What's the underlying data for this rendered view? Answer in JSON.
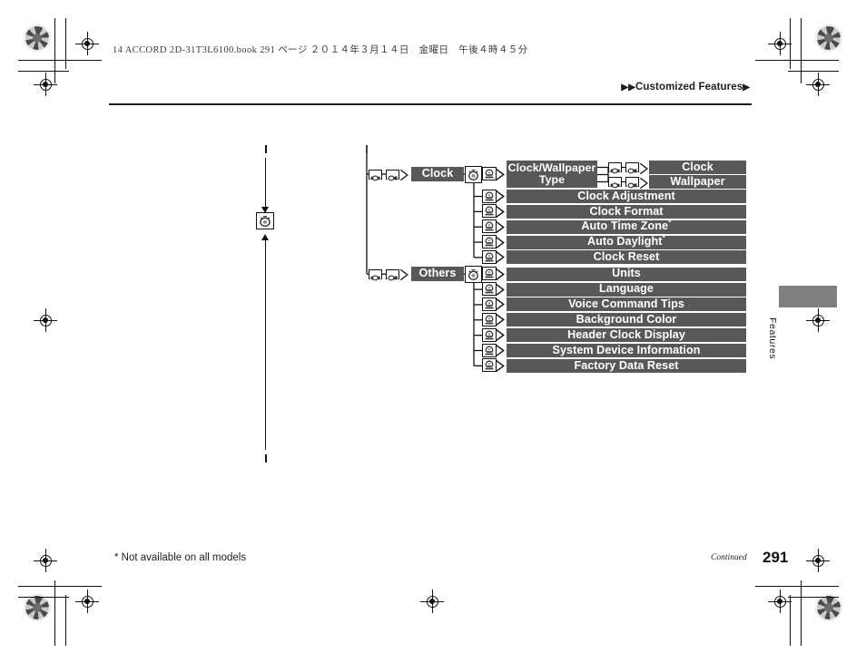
{
  "page": {
    "book_line": "14 ACCORD 2D-31T3L6100.book  291 ページ  ２０１４年３月１４日　金曜日　午後４時４５分",
    "running_head": "Customized Features",
    "running_head_tri_left": "▶▶",
    "running_head_tri_right": "▶",
    "side_tab_label": "Features",
    "footnote": "* Not available on all models",
    "continued": "Continued",
    "page_number": "291"
  },
  "colors": {
    "bar_fill": "#585858",
    "bar_text": "#ffffff",
    "line": "#111111",
    "side_tab": "#808080"
  },
  "diagram": {
    "branches": [
      {
        "id": "clock",
        "label": "Clock",
        "items": [
          {
            "label": "Clock/Wallpaper Type",
            "two_line": true,
            "star": false,
            "sub": [
              {
                "label": "Clock"
              },
              {
                "label": "Wallpaper"
              }
            ]
          },
          {
            "label": "Clock Adjustment",
            "star": false,
            "sub": []
          },
          {
            "label": "Clock Format",
            "star": false,
            "sub": []
          },
          {
            "label": "Auto Time Zone",
            "star": true,
            "sub": []
          },
          {
            "label": "Auto Daylight",
            "star": true,
            "sub": []
          },
          {
            "label": "Clock Reset",
            "star": false,
            "sub": []
          }
        ]
      },
      {
        "id": "others",
        "label": "Others",
        "items": [
          {
            "label": "Units",
            "star": false,
            "sub": []
          },
          {
            "label": "Language",
            "star": false,
            "sub": []
          },
          {
            "label": "Voice Command Tips",
            "star": false,
            "sub": []
          },
          {
            "label": "Background Color",
            "star": false,
            "sub": []
          },
          {
            "label": "Header Clock Display",
            "star": false,
            "sub": []
          },
          {
            "label": "System Device Information",
            "star": false,
            "sub": []
          },
          {
            "label": "Factory Data Reset",
            "star": false,
            "sub": []
          }
        ]
      }
    ],
    "icons": {
      "selector_knob": "selector-knob-icon",
      "enter_button": "enter-button-icon",
      "menu_button": "menu-button-icon",
      "arrow": "arrow-right-icon"
    }
  }
}
